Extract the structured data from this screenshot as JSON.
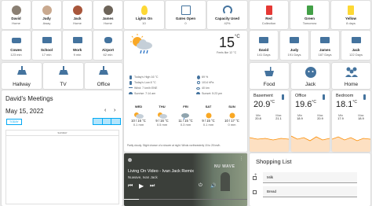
{
  "people": [
    {
      "name": "David",
      "state": "Home"
    },
    {
      "name": "Judy",
      "state": "Away"
    },
    {
      "name": "Jack",
      "state": "Home"
    },
    {
      "name": "James",
      "state": "Home"
    }
  ],
  "sensors_top": [
    {
      "name": "Lights On",
      "state": "10"
    },
    {
      "name": "Gates Open",
      "state": "0"
    },
    {
      "name": "Capacity Used",
      "state": "42%"
    },
    {
      "name": "Red",
      "state": "Collection"
    },
    {
      "name": "Green",
      "state": "Tomorrow"
    },
    {
      "name": "Yellow",
      "state": "8 days"
    }
  ],
  "places": [
    {
      "name": "Cowes",
      "state": "123 min"
    },
    {
      "name": "School",
      "state": "17 min"
    },
    {
      "name": "Work",
      "state": "9 min"
    },
    {
      "name": "Airport",
      "state": "62 min"
    }
  ],
  "birthdays": [
    {
      "name": "David",
      "state": "141 Days"
    },
    {
      "name": "Judy",
      "state": "191 Days"
    },
    {
      "name": "James",
      "state": "187 Days"
    },
    {
      "name": "Jack",
      "state": "122 Days"
    }
  ],
  "rooms": [
    "Hallway",
    "TV",
    "Office"
  ],
  "buttons": [
    "Food",
    "Jack",
    "Home"
  ],
  "weather": {
    "temp": "15",
    "unit": "°C",
    "feels": "Feels like 12 °C",
    "details_left": [
      "Today's High 16 °C",
      "Today's Low 8 °C",
      "Wind: 7 km/h ENE",
      "Sunrise: 7:14 am"
    ],
    "details_right": [
      "69 %",
      "1014 hPa",
      "40 km",
      "Sunset: 5:23 pm"
    ],
    "forecast": [
      {
        "day": "WED",
        "temp": "10 / 16 °C",
        "rain": "0.1 mm"
      },
      {
        "day": "THU",
        "temp": "9 / 16 °C",
        "rain": "0.5 mm"
      },
      {
        "day": "FRI",
        "temp": "11 / 15 °C",
        "rain": "0.3 mm"
      },
      {
        "day": "SAT",
        "temp": "9 / 15 °C",
        "rain": "0.1 mm"
      },
      {
        "day": "SUN",
        "temp": "10 / 17 °C",
        "rain": "0 mm"
      }
    ],
    "summary": "Partly cloudy. Slight chance of a shower at night. Winds northwesterly 15 to 25 km/h."
  },
  "calendar": {
    "title": "David's Meetings",
    "date": "May 15, 2022",
    "today": "TODAY",
    "day_header": "SUNDAY"
  },
  "temps": [
    {
      "name": "Basement",
      "value": "20.9",
      "unit": "°C",
      "min": "20.8",
      "max": "21.1"
    },
    {
      "name": "Office",
      "value": "19.6",
      "unit": "°C",
      "min": "18.9",
      "max": "20.9"
    },
    {
      "name": "Bedroom",
      "value": "18.1",
      "unit": "°C",
      "min": "17.9",
      "max": "18.9"
    }
  ],
  "labels": {
    "min": "Min",
    "max": "Max"
  },
  "media": {
    "title": "Living On Video - Ivan Jack Remix",
    "artist": "Nuwave, Ivan Jack",
    "art_text": "NU WAVE"
  },
  "shopping": {
    "title": "Shopping List",
    "items": [
      "Milk",
      "Bread"
    ]
  }
}
